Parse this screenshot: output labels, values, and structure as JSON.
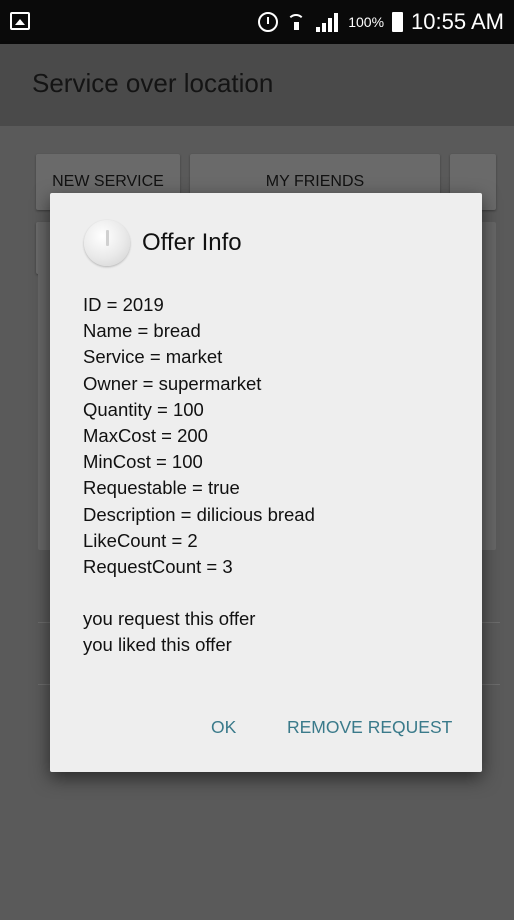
{
  "status_bar": {
    "battery_text": "100%",
    "time": "10:55 AM",
    "icons": [
      "gallery-icon",
      "alarm-icon",
      "wifi-icon",
      "signal-icon",
      "battery-icon"
    ]
  },
  "app": {
    "title": "Service over location",
    "buttons": {
      "new_service": "NEW SERVICE",
      "my_friends": "MY FRIENDS"
    }
  },
  "dialog": {
    "title": "Offer Info",
    "info_lines": [
      "ID = 2019",
      "Name = bread",
      "Service = market",
      "Owner = supermarket",
      "Quantity = 100",
      "MaxCost = 200",
      "MinCost = 100",
      "Requestable = true",
      "Description = dilicious bread",
      "LikeCount = 2",
      "RequestCount = 3"
    ],
    "status_lines": [
      "you request this offer",
      "you liked this offer"
    ],
    "ok_label": "OK",
    "remove_request_label": "REMOVE REQUEST"
  },
  "colors": {
    "accent_button_text": "#3a7a8a",
    "dialog_background": "#eeeeee",
    "scrim": "#5a5a5a"
  }
}
